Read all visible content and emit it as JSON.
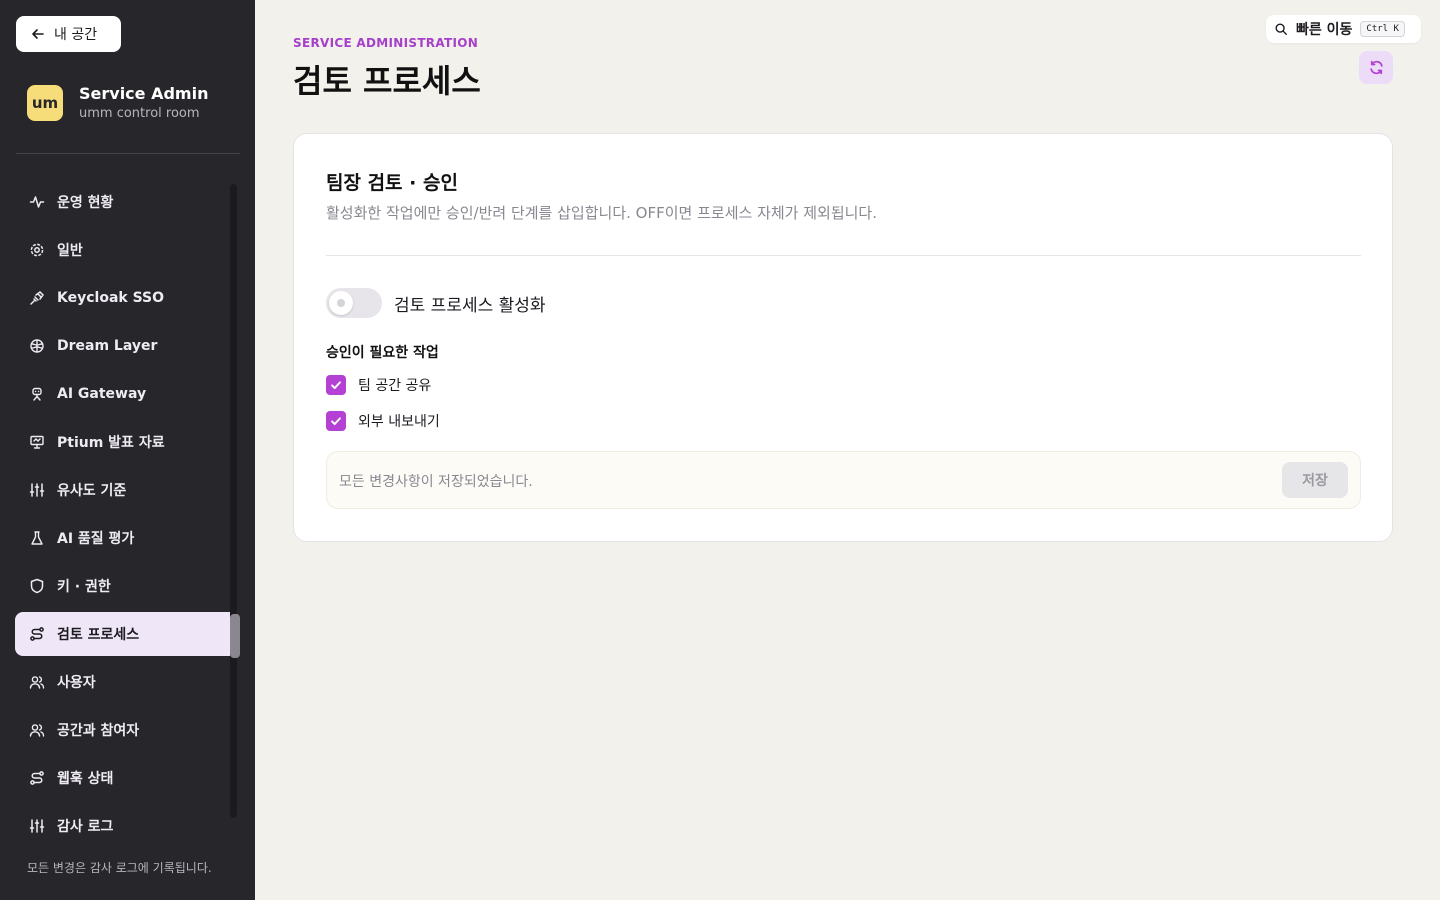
{
  "sidebar": {
    "back_label": "내 공간",
    "brand": {
      "logo_text": "um",
      "title": "Service Admin",
      "subtitle": "umm control room"
    },
    "items": [
      {
        "label": "운영 현황",
        "icon": "activity-icon"
      },
      {
        "label": "일반",
        "icon": "gear-icon"
      },
      {
        "label": "Keycloak SSO",
        "icon": "plug-icon"
      },
      {
        "label": "Dream Layer",
        "icon": "brain-icon"
      },
      {
        "label": "AI Gateway",
        "icon": "robot-icon"
      },
      {
        "label": "Ptium 발표 자료",
        "icon": "presentation-icon"
      },
      {
        "label": "유사도 기준",
        "icon": "sliders-icon"
      },
      {
        "label": "AI 품질 평가",
        "icon": "flask-icon"
      },
      {
        "label": "키 · 권한",
        "icon": "shield-icon"
      },
      {
        "label": "검토 프로세스",
        "icon": "route-icon",
        "active": true
      },
      {
        "label": "사용자",
        "icon": "users-icon"
      },
      {
        "label": "공간과 참여자",
        "icon": "users-icon"
      },
      {
        "label": "웹훅 상태",
        "icon": "route-icon"
      },
      {
        "label": "감사 로그",
        "icon": "sliders-icon"
      }
    ],
    "footer": "모든 변경은 감사 로그에 기록됩니다."
  },
  "header": {
    "eyebrow": "SERVICE ADMINISTRATION",
    "title": "검토 프로세스",
    "quick_nav": {
      "label": "빠른 이동",
      "shortcut": "Ctrl K"
    }
  },
  "card": {
    "title": "팀장 검토 · 승인",
    "description": "활성화한 작업에만 승인/반려 단계를 삽입합니다. OFF이면 프로세스 자체가 제외됩니다.",
    "toggle": {
      "label": "검토 프로세스 활성화",
      "on": false
    },
    "section_label": "승인이 필요한 작업",
    "checks": [
      {
        "label": "팀 공간 공유",
        "checked": true
      },
      {
        "label": "외부 내보내기",
        "checked": true
      }
    ],
    "save_bar": {
      "message": "모든 변경사항이 저장되었습니다.",
      "button": "저장"
    }
  },
  "colors": {
    "accent": "#b441d4",
    "sidebar_bg": "#27262b",
    "page_bg": "#f3f1ec",
    "brand_logo": "#f7dc7a"
  }
}
